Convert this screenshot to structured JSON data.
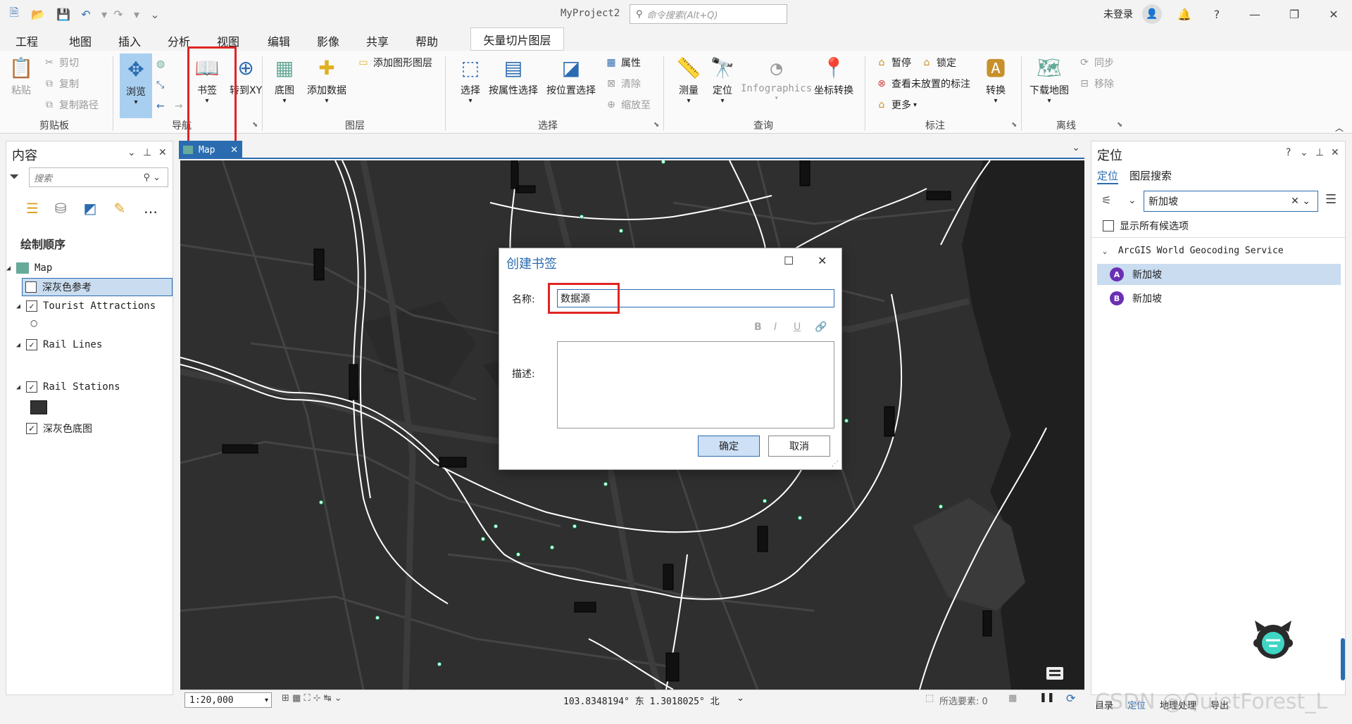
{
  "titlebar": {
    "app_title": "MyProject2",
    "cmd_search_placeholder": "命令搜索(Alt+Q)",
    "login_label": "未登录"
  },
  "ribbon": {
    "tabs": [
      "工程",
      "地图",
      "插入",
      "分析",
      "视图",
      "编辑",
      "影像",
      "共享",
      "帮助"
    ],
    "active_tab": "地图",
    "contextual_tab": "矢量切片图层",
    "clipboard": {
      "paste": "粘贴",
      "cut": "剪切",
      "copy": "复制",
      "copy_path": "复制路径",
      "label": "剪贴板"
    },
    "navigate": {
      "explore": "浏览",
      "bookmarks": "书签",
      "goto_xy": "转到XY",
      "label": "导航"
    },
    "layer": {
      "basemap": "底图",
      "add_data": "添加数据",
      "add_graphics": "添加图形图层",
      "label": "图层"
    },
    "selection": {
      "select": "选择",
      "by_attr": "按属性选择",
      "by_loc": "按位置选择",
      "attributes": "属性",
      "clear": "清除",
      "zoom_to": "缩放至",
      "label": "选择"
    },
    "inquiry": {
      "measure": "测量",
      "locate": "定位",
      "infographics": "Infographics",
      "coord_convert": "坐标转换",
      "label": "查询"
    },
    "labeling": {
      "pause": "暂停",
      "lock": "锁定",
      "view_unplaced": "查看未放置的标注",
      "more": "更多",
      "convert": "转换",
      "label": "标注"
    },
    "offline": {
      "download": "下载地图",
      "sync": "同步",
      "remove": "移除",
      "label": "离线"
    }
  },
  "contents": {
    "title": "内容",
    "search_placeholder": "搜索",
    "draw_order": "绘制顺序",
    "layers": [
      {
        "name": "Map",
        "checked": null
      },
      {
        "name": "深灰色参考",
        "checked": false
      },
      {
        "name": "Tourist Attractions",
        "checked": true
      },
      {
        "name": "Rail Lines",
        "checked": true
      },
      {
        "name": "Rail Stations",
        "checked": true
      },
      {
        "name": "深灰色底图",
        "checked": true
      }
    ]
  },
  "map_view": {
    "tab_label": "Map",
    "scale": "1:20,000",
    "coordinates": "103.8348194° 东  1.3018025° 北",
    "selected_features": "所选要素: 0"
  },
  "locate_pane": {
    "title": "定位",
    "tabs": [
      "定位",
      "图层搜索"
    ],
    "query": "新加坡",
    "show_all_label": "显示所有候选项",
    "service": "ArcGIS World Geocoding Service",
    "results": [
      {
        "pin": "A",
        "name": "新加坡"
      },
      {
        "pin": "B",
        "name": "新加坡"
      }
    ],
    "footer_tabs": [
      "目录",
      "定位",
      "地理处理",
      "导出"
    ]
  },
  "dialog": {
    "title": "创建书签",
    "name_label": "名称:",
    "name_value": "数据源",
    "desc_label": "描述:",
    "format_buttons": [
      "B",
      "I",
      "U"
    ],
    "ok": "确定",
    "cancel": "取消"
  },
  "watermark": "CSDN @QuietForest_L",
  "colors": {
    "accent": "#2b6cb0",
    "highlight": "#e02424",
    "map_bg": "#2f2f2f"
  }
}
